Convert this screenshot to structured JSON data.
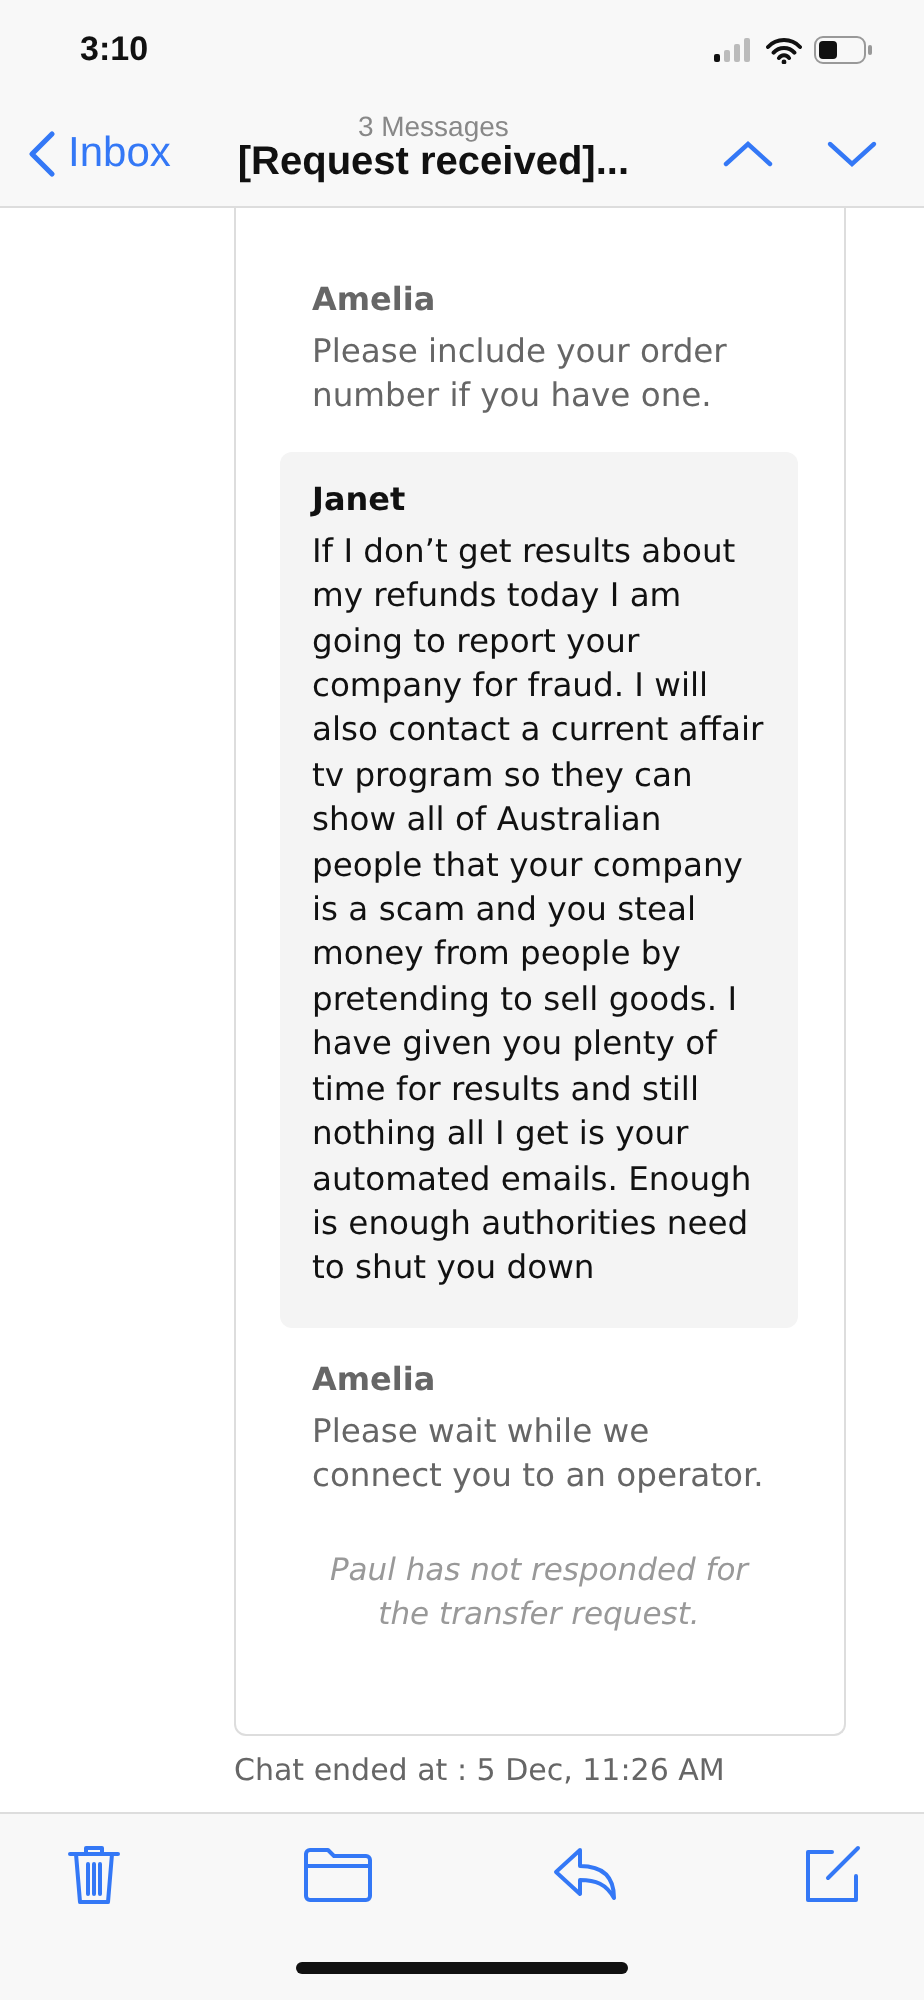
{
  "status_bar": {
    "time": "3:10"
  },
  "nav": {
    "back": "Inbox",
    "subtitle": "3 Messages",
    "title": "[Request received]..."
  },
  "messages": [
    {
      "kind": "agent",
      "sender": "Amelia",
      "text": "Please include your order number if you have one."
    },
    {
      "kind": "customer",
      "sender": "Janet",
      "text": "If I don’t get results about my refunds today I am going to report your company for fraud. I will also contact a current affair tv program so they can show all of Australian people that your company is a scam and you steal money from people by pretending to sell goods. I have given you plenty of time for results and still nothing all I get is your automated emails. Enough is enough authorities need to shut you down"
    },
    {
      "kind": "agent",
      "sender": "Amelia",
      "text": "Please wait while we connect you to an operator."
    },
    {
      "kind": "notice",
      "text": "Paul has not responded for the transfer request."
    }
  ],
  "footer_note": "Chat ended at : 5 Dec, 11:26 AM"
}
